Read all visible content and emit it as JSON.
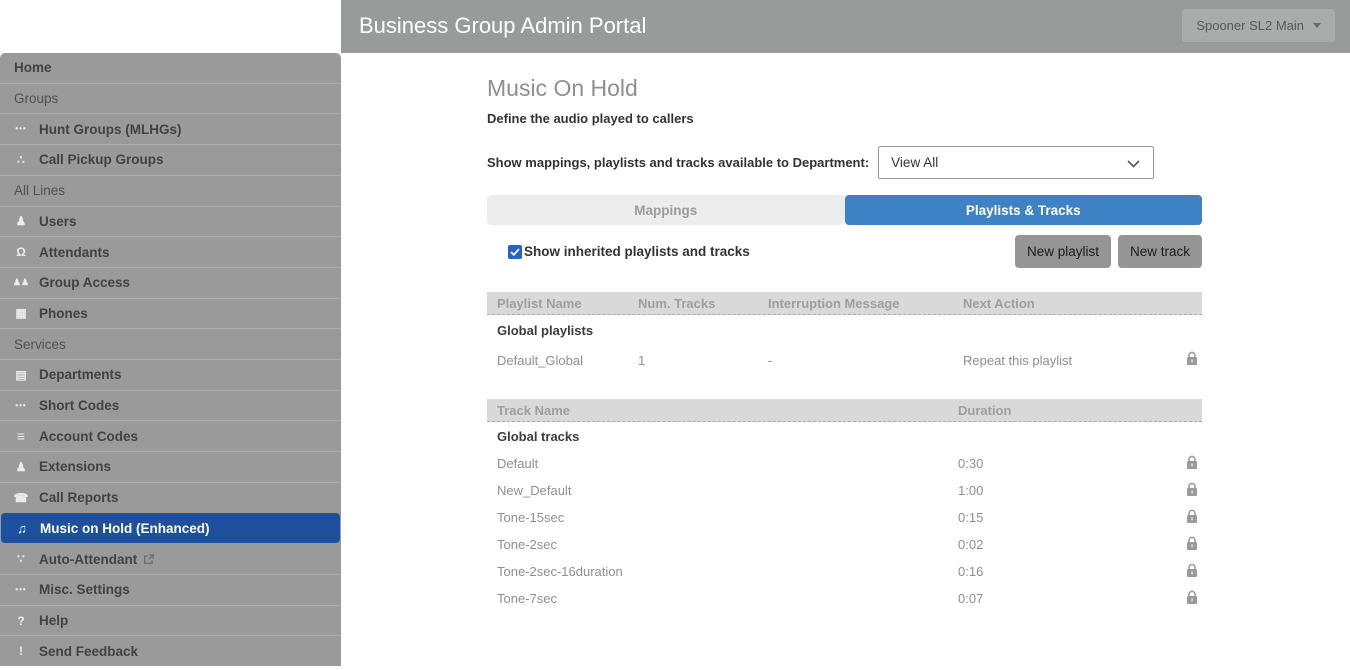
{
  "header": {
    "title": "Business Group Admin Portal",
    "account_selector": "Spooner SL2 Main"
  },
  "sidebar": {
    "items": [
      {
        "label": "Home",
        "type": "link"
      },
      {
        "label": "Groups",
        "type": "section"
      },
      {
        "label": "Hunt Groups (MLHGs)",
        "type": "link",
        "icon": "hunt-groups-icon"
      },
      {
        "label": "Call Pickup Groups",
        "type": "link",
        "icon": "call-pickup-groups-icon"
      },
      {
        "label": "All Lines",
        "type": "section"
      },
      {
        "label": "Users",
        "type": "link",
        "icon": "users-icon"
      },
      {
        "label": "Attendants",
        "type": "link",
        "icon": "attendants-icon"
      },
      {
        "label": "Group Access",
        "type": "link",
        "icon": "group-access-icon"
      },
      {
        "label": "Phones",
        "type": "link",
        "icon": "phones-icon"
      },
      {
        "label": "Services",
        "type": "section"
      },
      {
        "label": "Departments",
        "type": "link",
        "icon": "departments-icon"
      },
      {
        "label": "Short Codes",
        "type": "link",
        "icon": "short-codes-icon"
      },
      {
        "label": "Account Codes",
        "type": "link",
        "icon": "account-codes-icon"
      },
      {
        "label": "Extensions",
        "type": "link",
        "icon": "extensions-icon"
      },
      {
        "label": "Call Reports",
        "type": "link",
        "icon": "call-reports-icon"
      },
      {
        "label": "Music on Hold (Enhanced)",
        "type": "link",
        "icon": "music-on-hold-icon",
        "selected": true
      },
      {
        "label": "Auto-Attendant",
        "type": "link",
        "icon": "auto-attendant-icon",
        "external": true
      },
      {
        "label": "Misc. Settings",
        "type": "link",
        "icon": "misc-settings-icon"
      },
      {
        "label": "Help",
        "type": "link",
        "icon": "help-icon"
      },
      {
        "label": "Send Feedback",
        "type": "link",
        "icon": "send-feedback-icon"
      }
    ]
  },
  "main": {
    "title": "Music On Hold",
    "subtitle": "Define the audio played to callers",
    "department_filter": {
      "label": "Show mappings, playlists and tracks available to Department:",
      "selected": "View All"
    },
    "tabs": [
      {
        "label": "Mappings",
        "active": false
      },
      {
        "label": "Playlists & Tracks",
        "active": true
      }
    ],
    "inherited_checkbox": {
      "label": "Show inherited playlists and tracks",
      "checked": true
    },
    "buttons": {
      "new_playlist": "New playlist",
      "new_track": "New track"
    },
    "playlists_table": {
      "columns": [
        "Playlist Name",
        "Num. Tracks",
        "Interruption Message",
        "Next Action"
      ],
      "group_label": "Global playlists",
      "rows": [
        {
          "name": "Default_Global",
          "num_tracks": "1",
          "interruption": "-",
          "next_action": "Repeat this playlist",
          "locked": true
        }
      ]
    },
    "tracks_table": {
      "columns": [
        "Track Name",
        "Duration"
      ],
      "group_label": "Global tracks",
      "rows": [
        {
          "name": "Default",
          "duration": "0:30",
          "locked": true
        },
        {
          "name": "New_Default",
          "duration": "1:00",
          "locked": true
        },
        {
          "name": "Tone-15sec",
          "duration": "0:15",
          "locked": true
        },
        {
          "name": "Tone-2sec",
          "duration": "0:02",
          "locked": true
        },
        {
          "name": "Tone-2sec-16duration",
          "duration": "0:16",
          "locked": true
        },
        {
          "name": "Tone-7sec",
          "duration": "0:07",
          "locked": true
        }
      ]
    }
  },
  "colors": {
    "header_bar": "#999b9b",
    "sidebar": "#9a9a9a",
    "selected_nav": "#1e509e",
    "active_tab": "#3d82c4",
    "checkbox": "#2563c9"
  }
}
